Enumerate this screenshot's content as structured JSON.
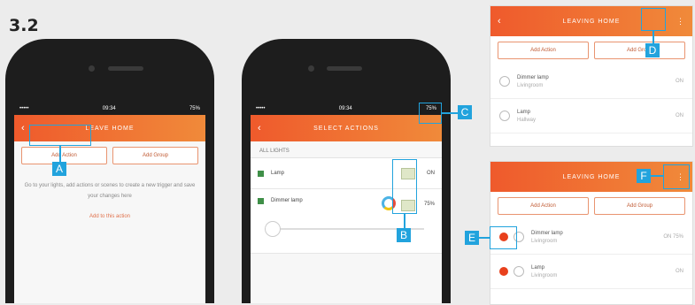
{
  "step": "3.2",
  "phone1": {
    "status": {
      "time": "09:34",
      "battery": "75%"
    },
    "title": "LEAVE HOME",
    "tabs": [
      "Add Action",
      "Add Group"
    ],
    "body_text": "Go to your lights, add actions or scenes to create a new trigger and save your changes here",
    "link": "Add to this action"
  },
  "phone2": {
    "status": {
      "time": "09:34",
      "battery": "75%"
    },
    "title": "SELECT ACTIONS",
    "section": "ALL LIGHTS",
    "rows": [
      {
        "name": "Lamp",
        "value": "ON"
      },
      {
        "name": "Dimmer lamp",
        "value": "75%"
      }
    ]
  },
  "panel_top": {
    "title": "LEAVING HOME",
    "tabs": [
      "Add Action",
      "Add Group"
    ],
    "rows": [
      {
        "name": "Dimmer lamp",
        "sub": "Livingroom",
        "value": "ON"
      },
      {
        "name": "Lamp",
        "sub": "Hallway",
        "value": "ON"
      }
    ]
  },
  "panel_bottom": {
    "title": "LEAVING HOME",
    "tabs": [
      "Add Action",
      "Add Group"
    ],
    "rows": [
      {
        "name": "Dimmer lamp",
        "sub": "Livingroom",
        "value": "ON 75%"
      },
      {
        "name": "Lamp",
        "sub": "Livingroom",
        "value": "ON"
      }
    ]
  },
  "callouts": [
    "A",
    "B",
    "C",
    "D",
    "E",
    "F"
  ],
  "colors": {
    "accent": "#22a3dd",
    "brand": "#ef5a2c"
  }
}
